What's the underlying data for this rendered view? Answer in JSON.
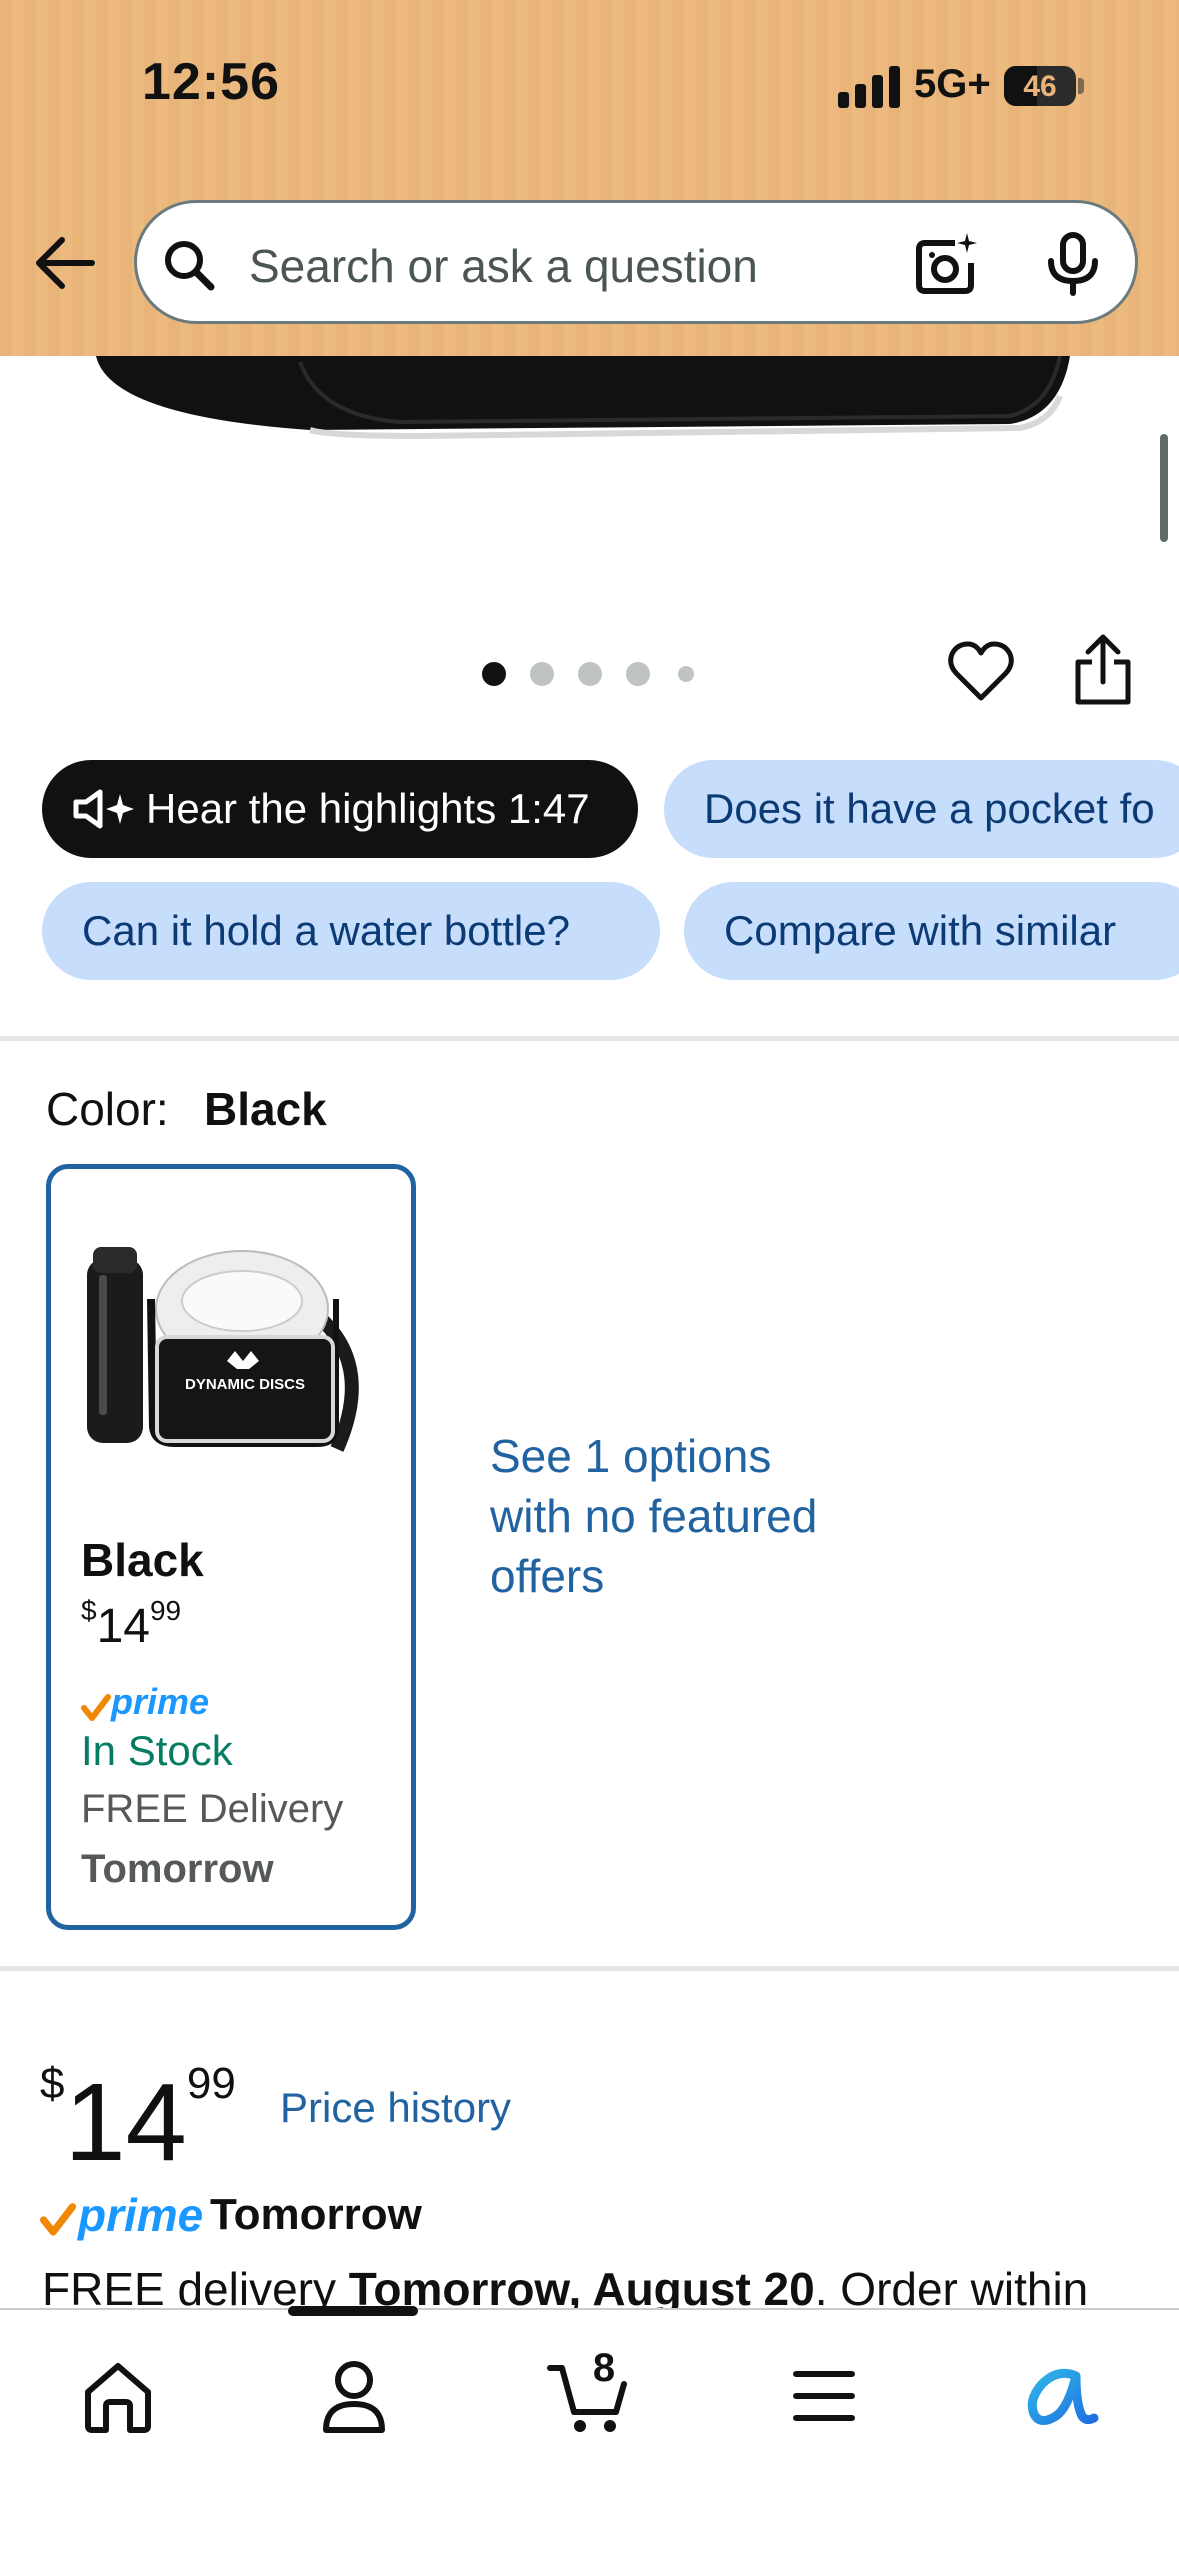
{
  "status_bar": {
    "time": "12:56",
    "network": "5G+",
    "battery": "46",
    "battery_level": 0.46
  },
  "search": {
    "placeholder": "Search or ask a question"
  },
  "image_carousel": {
    "dot_count": 5,
    "active_index": 0
  },
  "chips": {
    "highlights": "Hear the highlights 1:47",
    "pocket": "Does it have a pocket fo",
    "water_bottle": "Can it hold a water bottle?",
    "compare": "Compare with similar"
  },
  "color_selector": {
    "label": "Color:",
    "value": "Black",
    "swatch": {
      "name": "Black",
      "price_currency": "$",
      "price_whole": "14",
      "price_fraction": "99",
      "prime_label": "prime",
      "stock": "In Stock",
      "delivery": "FREE Delivery",
      "delivery_day": "Tomorrow",
      "image_brand_text": "DYNAMIC DISCS"
    },
    "no_offers_link": "See 1 options with no featured offers"
  },
  "buybox": {
    "price_currency": "$",
    "price_whole": "14",
    "price_fraction": "99",
    "price_history": "Price history",
    "prime_label": "prime",
    "prime_day": "Tomorrow",
    "delivery_prefix": "FREE delivery ",
    "delivery_date": "Tomorrow, August 20",
    "delivery_suffix": ". Order within"
  },
  "bottom_nav": {
    "items": [
      "home-icon",
      "account-icon",
      "cart-icon",
      "menu-icon",
      "rufus-icon"
    ],
    "cart_count": "8"
  },
  "colors": {
    "header_bg": "#e9b479",
    "link": "#2162a1",
    "chip_bg": "#c6defc",
    "in_stock": "#067d62",
    "prime_blue": "#1a98ff",
    "prime_check": "#f08804"
  }
}
